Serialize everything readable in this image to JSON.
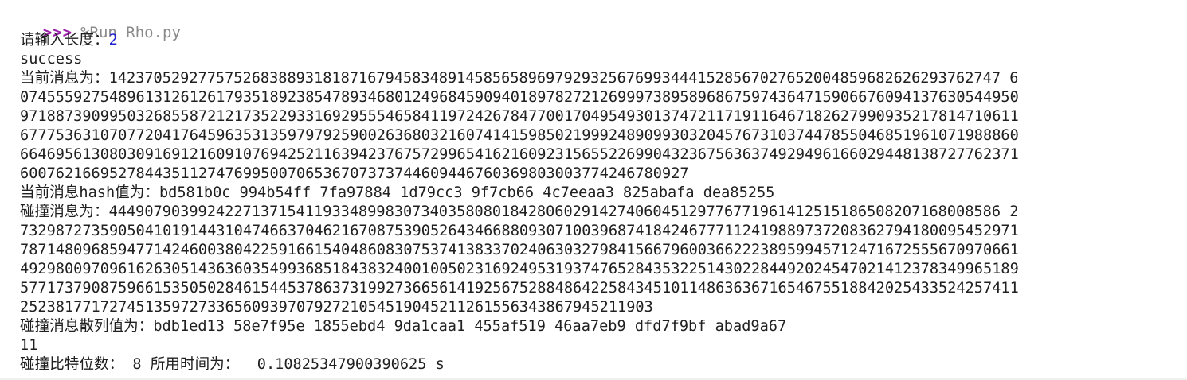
{
  "shell": {
    "prompt": ">>>",
    "command": "%Run Rho.py"
  },
  "output": {
    "length_prompt": "请输入长度：",
    "length_value": "2",
    "status": "success",
    "message_label": "当前消息为：",
    "message_lines": [
      "1423705292775752683889318187167945834891458565896979293256769934441528567027652004859682626293762747 6",
      "0745559275489613126126179351892385478934680124968459094018978272126999738958968675974364715906676094137630544950",
      "9718873909950326855872121735229331692955546584119724267847700170495493013747211719116467182627990935217814710611",
      "6777536310707720417645963531359797925900263680321607414159850219992489099303204576731037447855046851961071988860",
      "6646956130803091691216091076942521163942376757299654162160923156552269904323675636374929496166029448138727762371",
      "600762166952784435112747699500706536707373744609446760369803003774246780927"
    ],
    "hash_label": "当前消息hash值为：",
    "hash_value": "bd581b0c 994b54ff 7fa97884 1d79cc3 9f7cb66 4c7eeaa3 825abafa dea85255",
    "collision_label": "碰撞消息为：",
    "collision_lines": [
      "4449079039924227137154119334899830734035808018428060291427406045129776771961412515186508207168008586 2",
      "7329872735905041019144310474663704621670875390526434668809307100396874184246777112419889737208362794180095452971",
      "7871480968594771424600380422591661540486083075374138337024063032798415667960036622238959945712471672555670970661",
      "4929800970961626305143636035499368518438324001005023169249531937476528435322514302284492024547021412378349965189",
      "5771737908759661535050284615445378637319927366561419256752884864225843451011486363671654675518842025433524257411",
      "25238177172745135972733656093970792721054519045211261556343867945211903"
    ],
    "collision_hash_label": "碰撞消息散列值为：",
    "collision_hash_value": "bdb1ed13 58e7f95e 1855ebd4 9da1caa1 455af519 46aa7eb9 dfd7f9bf abad9a67",
    "count": "11",
    "summary_label": "碰撞比特位数：",
    "summary_bits": "8",
    "time_label": "所用时间为：",
    "time_value": "0.10825347900390625",
    "time_unit": "s"
  },
  "colors": {
    "prompt": "#9a1aa8",
    "command": "#8a8a8a",
    "user_input": "#1f1fd0",
    "text": "#202020",
    "background": "#ffffff"
  }
}
